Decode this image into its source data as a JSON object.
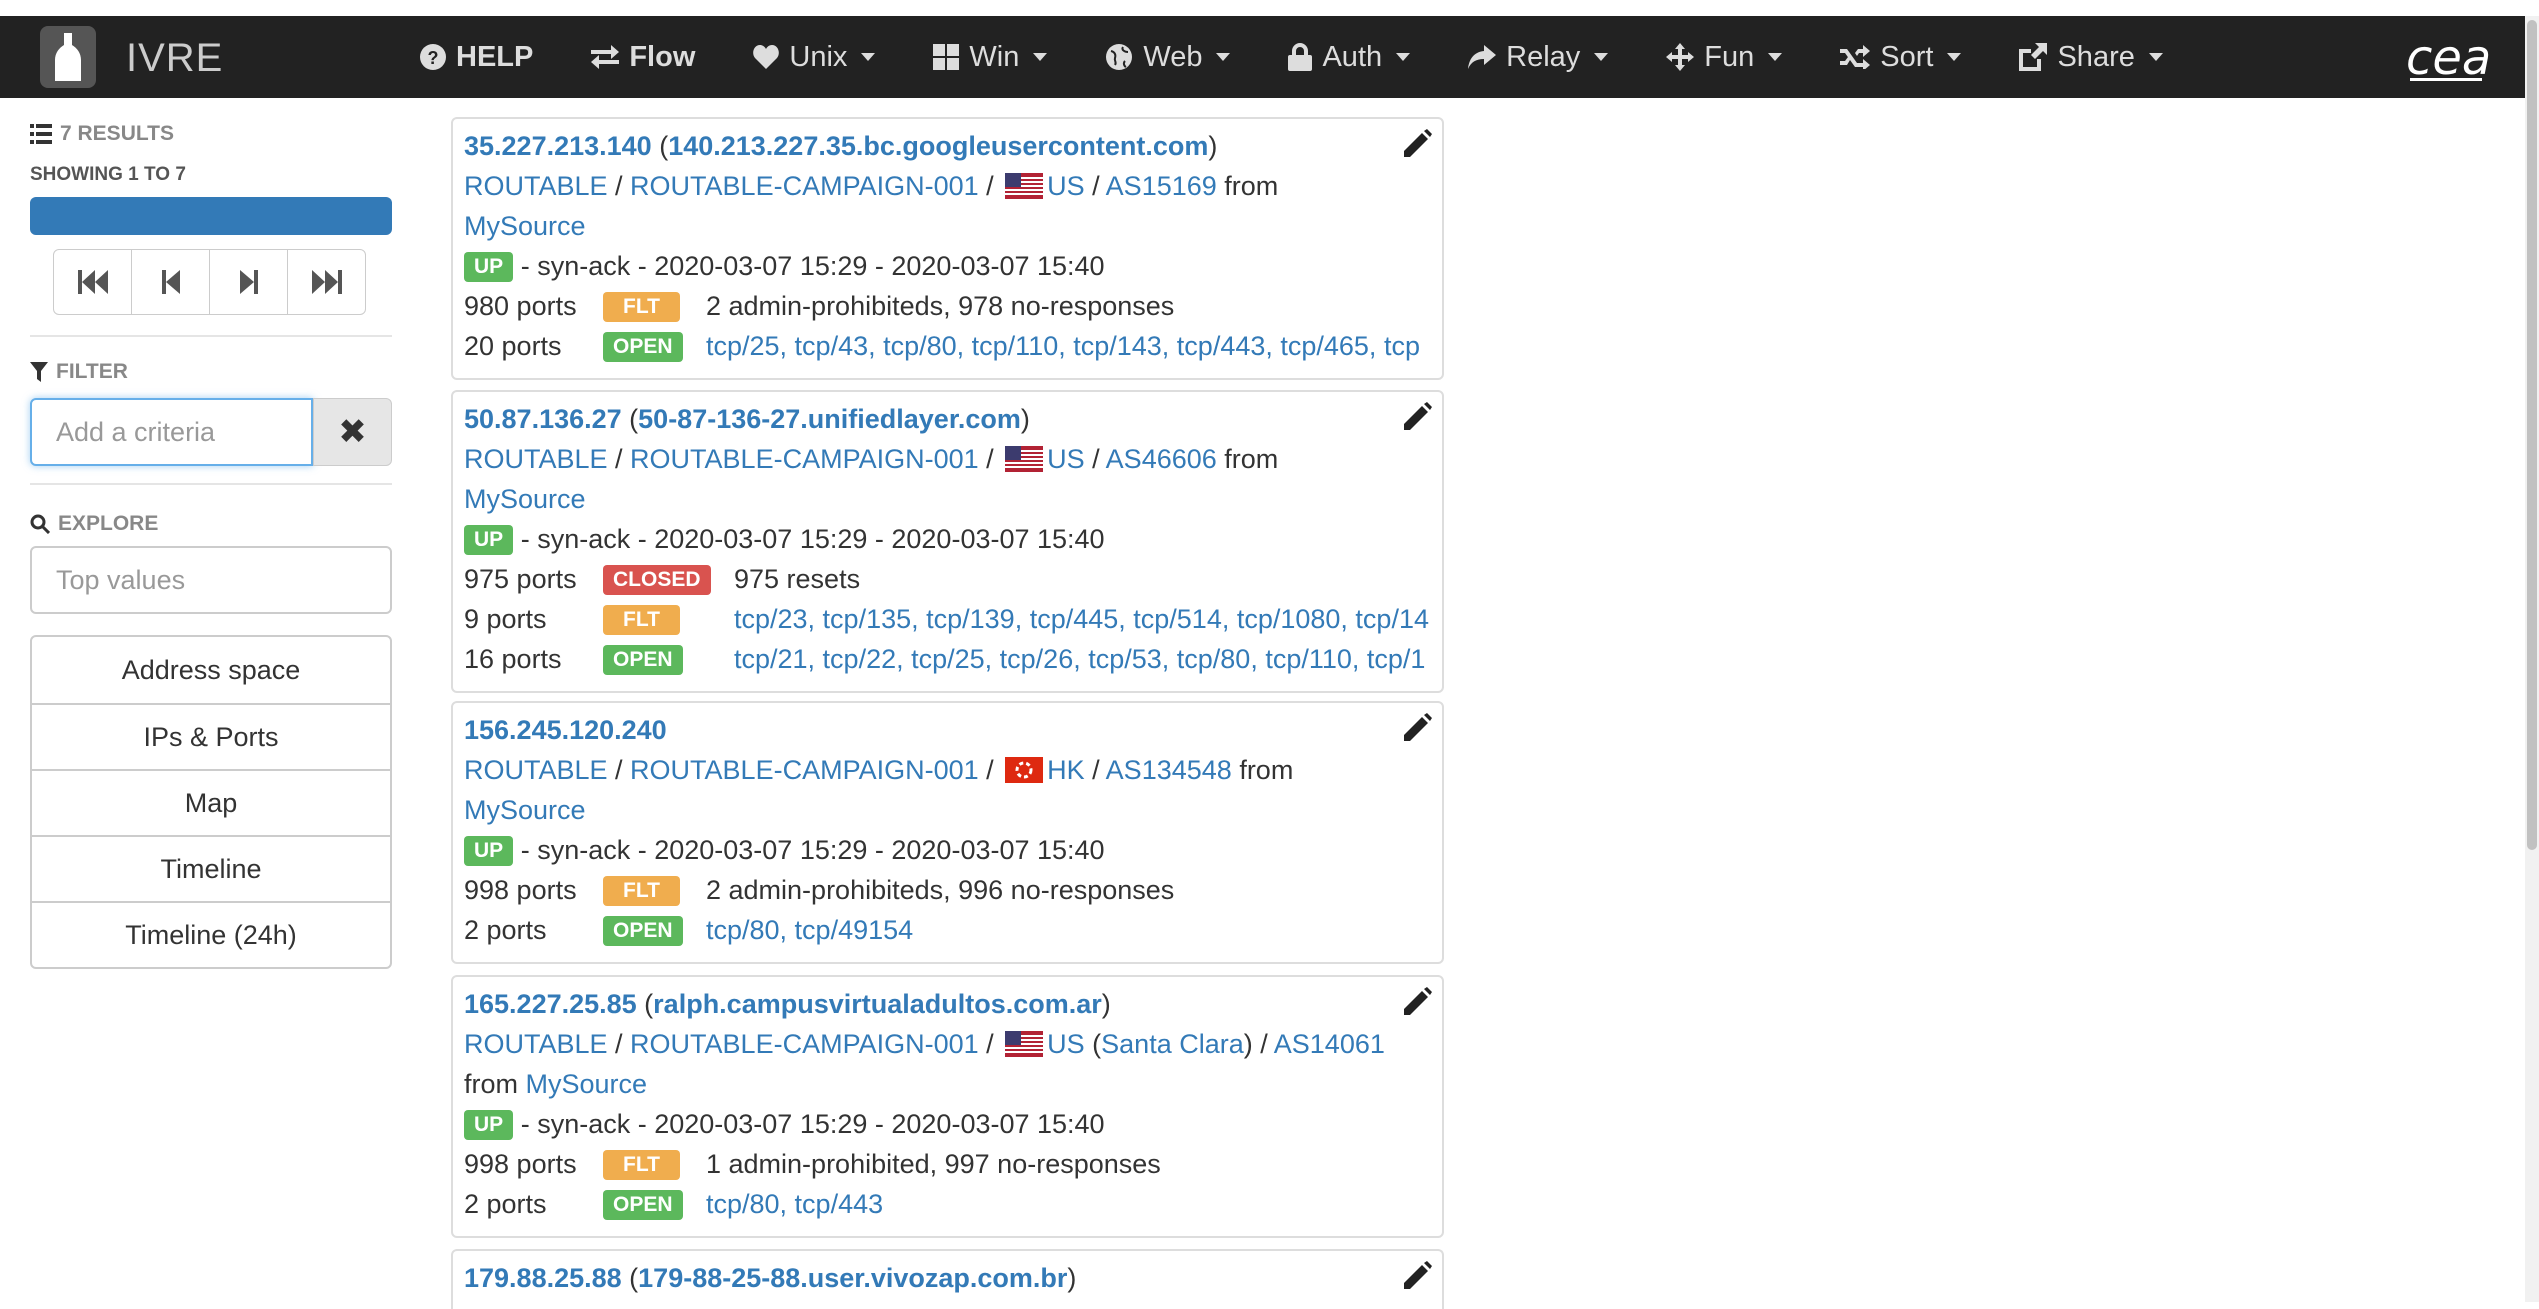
{
  "brand": {
    "name": "IVRE"
  },
  "nav": [
    {
      "label": "HELP",
      "icon": "help-icon",
      "bold": true
    },
    {
      "label": "Flow",
      "icon": "flow-icon",
      "bold": true
    },
    {
      "label": "Unix",
      "icon": "heart-icon"
    },
    {
      "label": "Win",
      "icon": "windows-icon"
    },
    {
      "label": "Web",
      "icon": "globe-icon"
    },
    {
      "label": "Auth",
      "icon": "lock-icon"
    },
    {
      "label": "Relay",
      "icon": "share-arrow-icon"
    },
    {
      "label": "Fun",
      "icon": "move-icon"
    },
    {
      "label": "Sort",
      "icon": "random-icon"
    },
    {
      "label": "Share",
      "icon": "external-share-icon"
    }
  ],
  "logo_right": "cea",
  "sidebar": {
    "results": "7 RESULTS",
    "showing": "SHOWING 1 TO 7",
    "filter_head": "FILTER",
    "filter_placeholder": "Add a criteria",
    "filter_clear": "✖",
    "explore_head": "EXPLORE",
    "explore_placeholder": "Top values",
    "explore_items": [
      "Address space",
      "IPs & Ports",
      "Map",
      "Timeline",
      "Timeline (24h)"
    ]
  },
  "hosts": [
    {
      "ip": "35.227.213.140",
      "hostname": "140.213.227.35.bc.googleusercontent.com",
      "cat1": "ROUTABLE",
      "cat2": "ROUTABLE-CAMPAIGN-001",
      "country": "US",
      "as": "AS15169",
      "from": "from",
      "source": "MySource",
      "status": "UP",
      "times": "- syn-ack - 2020-03-07 15:29 - 2020-03-07 15:40",
      "ports": [
        {
          "count": "980 ports",
          "label": "FLT",
          "detail": "2 admin-prohibiteds, 978 no-responses"
        },
        {
          "count": "20 ports",
          "label": "OPEN",
          "detail": "tcp/25, tcp/43, tcp/80, tcp/110, tcp/143, tcp/443, tcp/465, tcp"
        }
      ]
    },
    {
      "ip": "50.87.136.27",
      "hostname": "50-87-136-27.unifiedlayer.com",
      "cat1": "ROUTABLE",
      "cat2": "ROUTABLE-CAMPAIGN-001",
      "country": "US",
      "as": "AS46606",
      "from": "from",
      "source": "MySource",
      "status": "UP",
      "times": "- syn-ack - 2020-03-07 15:29 - 2020-03-07 15:40",
      "ports": [
        {
          "count": "975 ports",
          "label": "CLOSED",
          "detail": "975 resets"
        },
        {
          "count": "9 ports",
          "label": "FLT",
          "detail": "tcp/23, tcp/135, tcp/139, tcp/445, tcp/514, tcp/1080, tcp/14"
        },
        {
          "count": "16 ports",
          "label": "OPEN",
          "detail": "tcp/21, tcp/22, tcp/25, tcp/26, tcp/53, tcp/80, tcp/110, tcp/1"
        }
      ]
    },
    {
      "ip": "156.245.120.240",
      "hostname": "",
      "cat1": "ROUTABLE",
      "cat2": "ROUTABLE-CAMPAIGN-001",
      "country": "HK",
      "as": "AS134548",
      "from": "from",
      "source": "MySource",
      "status": "UP",
      "times": "- syn-ack - 2020-03-07 15:29 - 2020-03-07 15:40",
      "ports": [
        {
          "count": "998 ports",
          "label": "FLT",
          "detail": "2 admin-prohibiteds, 996 no-responses"
        },
        {
          "count": "2 ports",
          "label": "OPEN",
          "detail": "tcp/80, tcp/49154"
        }
      ]
    },
    {
      "ip": "165.227.25.85",
      "hostname": "ralph.campusvirtualadultos.com.ar",
      "cat1": "ROUTABLE",
      "cat2": "ROUTABLE-CAMPAIGN-001",
      "country": "US",
      "city": "Santa Clara",
      "as": "AS14061",
      "from": "from",
      "source": "MySource",
      "status": "UP",
      "times": "- syn-ack - 2020-03-07 15:29 - 2020-03-07 15:40",
      "ports": [
        {
          "count": "998 ports",
          "label": "FLT",
          "detail": "1 admin-prohibited, 997 no-responses"
        },
        {
          "count": "2 ports",
          "label": "OPEN",
          "detail": "tcp/80, tcp/443"
        }
      ]
    },
    {
      "ip": "179.88.25.88",
      "hostname": "179-88-25-88.user.vivozap.com.br"
    }
  ],
  "colors": {
    "link": "#337ab7",
    "up": "#5cb85c",
    "flt": "#f0ad4e",
    "closed": "#d9534f",
    "navbar": "#222222"
  }
}
